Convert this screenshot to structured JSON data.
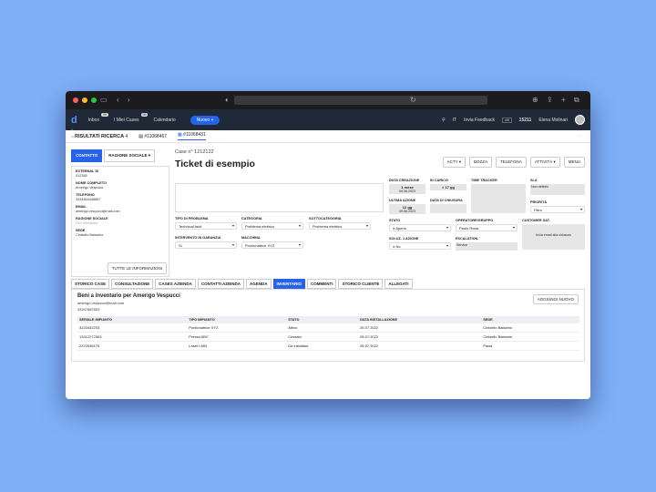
{
  "browser": {
    "dots": [
      "#ff5f57",
      "#febc2e",
      "#28c840"
    ]
  },
  "appbar": {
    "logo": "d",
    "logo_sub": "s-link",
    "nav": [
      {
        "label": "Inbox",
        "badge": "99"
      },
      {
        "label": "I Miei Cases",
        "badge": "99"
      },
      {
        "label": "Calendario",
        "badge": ""
      }
    ],
    "new_button": "Nuovo +",
    "lang": "IT",
    "feedback": "Invia Feedback",
    "feedback_key": "ctrl",
    "count": "15211",
    "user": "Elena Molinari"
  },
  "tabs": {
    "results": "RISULTATI RICERCA",
    "results_count": "4",
    "tab1": "#11068467",
    "tab2": "#11068431"
  },
  "contact": {
    "tab_contact": "CONTATTO",
    "tab_company": "RAGIONE SOCIALE ▾",
    "fields": [
      {
        "label": "EXTERNAL ID",
        "value": "012345"
      },
      {
        "label": "NOME COMPLETO",
        "value": "Amerigo Vespucci"
      },
      {
        "label": "TELEFONO",
        "value": "3334564448887"
      },
      {
        "label": "EMAIL",
        "value": "amerigo.vespucci@mail.com"
      },
      {
        "label": "RAGIONE SOCIALE",
        "value": "Non dichiarata"
      },
      {
        "label": "SEDE",
        "value": "Cinisello Balsamo"
      }
    ],
    "button": "TUTTE LE INFORMAZIONI"
  },
  "case": {
    "number": "Case n° 1212122",
    "title": "Ticket di esempio",
    "actions": [
      "ACTY",
      "BOZZA",
      "TELEFONA",
      "ATTIVITÀ",
      "MENU"
    ]
  },
  "form": {
    "tipo_problema": {
      "label": "TIPO DI PROBLEMA",
      "value": "Technical fault"
    },
    "categoria": {
      "label": "CATEGORIA",
      "value": "Problema elettrico"
    },
    "sottocategoria": {
      "label": "SOTTOCATEGORIA",
      "value": "Problema elettrico"
    },
    "garanzia": {
      "label": "INTERVENTO IN GARANZIA",
      "value": "Sì"
    },
    "macchina": {
      "label": "MACCHINA",
      "value": "Porzionatrice XYZ"
    }
  },
  "meta": {
    "data_creazione": {
      "label": "DATA CREAZIONE",
      "big": "1 mese",
      "small": "09.06.2023"
    },
    "in_carico": {
      "label": "IN CARICO",
      "big": "> 17 gg"
    },
    "time_tracker": "TIME TRACKER",
    "sla": {
      "label": "SLA",
      "value": "Non definito"
    },
    "ultima_azione": {
      "label": "ULTIMA AZIONE",
      "big": "12 gg",
      "small": "09.06.2023"
    },
    "data_chiusura": "DATA DI CHIUSURA",
    "priorita": {
      "label": "PRIORITÀ",
      "value": "Filtro"
    },
    "stato": {
      "label": "STATO",
      "value": "Aperto"
    },
    "operatore": {
      "label": "OPERATORE/GRUPPO",
      "value": "Paolo Rossi"
    },
    "customer_sat": {
      "label": "CUSTOMER SAT.",
      "value": "Invia email alla chiusura"
    },
    "soluz": {
      "label": "SOLUZ. 1 AZIONE",
      "value": "No"
    },
    "escalation": {
      "label": "ESCALATION",
      "value": "Service"
    }
  },
  "bottom_tabs": [
    "STORICO CASE",
    "CONSULTAZIONE",
    "CASES AZIENDA",
    "CONTATTI AZIENDA",
    "AGENDA",
    "INVENTARIO",
    "COMMENTI",
    "STORICO CLIENTE",
    "ALLEGATI"
  ],
  "inventory": {
    "title": "Beni a inventario per Amerigo Vespucci",
    "email": "amerigo.vespucci@mail.com",
    "phone": "33347887653",
    "add_button": "AGGIUNGI NUOVO",
    "columns": [
      "SERIALE IMPIANTO",
      "TIPO IMPIANTO",
      "STATO",
      "DATA INSTALLAZIONE",
      "SEDE"
    ],
    "rows": [
      [
        "3223432233",
        "Porzionatrice XYZ",
        "Attivo",
        "25.07.2022",
        "Cinisello Balsamo"
      ],
      [
        "13412272363",
        "Pressa ABC",
        "Cessato",
        "05.07.2022",
        "Cinisello Balsamo"
      ],
      [
        "2372636176",
        "Laser LMN",
        "Da installare",
        "05.07.2022",
        "Pavia"
      ]
    ]
  }
}
